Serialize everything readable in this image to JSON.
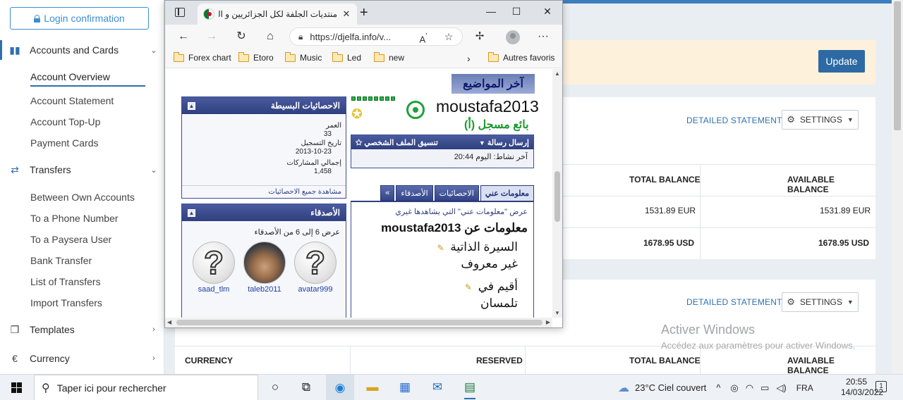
{
  "sidebar": {
    "login_label": "Login confirmation",
    "groups": [
      {
        "label": "Accounts and Cards",
        "icon": "cards-icon"
      },
      {
        "label": "Transfers",
        "icon": "transfer-icon"
      },
      {
        "label": "Templates",
        "icon": "templates-icon"
      },
      {
        "label": "Currency",
        "icon": "currency-icon"
      }
    ],
    "accounts_items": [
      "Account Overview",
      "Account Statement",
      "Account Top-Up",
      "Payment Cards"
    ],
    "transfers_items": [
      "Between Own Accounts",
      "To a Phone Number",
      "To a Paysera User",
      "Bank Transfer",
      "List of Transfers",
      "Import Transfers"
    ]
  },
  "alert": {
    "update_label": "Update"
  },
  "card1": {
    "detailed_label": "DETAILED STATEMENT",
    "settings_label": "SETTINGS",
    "headers": [
      "TOTAL BALANCE",
      "AVAILABLE BALANCE"
    ],
    "rows": [
      [
        "1531.89 EUR",
        "1531.89 EUR"
      ],
      [
        "1678.95 USD",
        "1678.95 USD"
      ]
    ]
  },
  "card2": {
    "detailed_label": "DETAILED STATEMENT",
    "settings_label": "SETTINGS",
    "headers": [
      "CURRENCY",
      "RESERVED",
      "TOTAL BALANCE",
      "AVAILABLE BALANCE"
    ]
  },
  "watermark": {
    "title": "Activer Windows",
    "subtitle": "Accédez aux paramètres pour activer Windows."
  },
  "browser": {
    "tab_title": "منتديات الجلفة لكل الجزائريين و العـ",
    "url": "https://djelfa.info/v...",
    "bookmarks": [
      "Forex chart",
      "Etoro",
      "Music",
      "Led",
      "new"
    ],
    "other_favorites": "Autres favoris"
  },
  "forum": {
    "latest_topics": "آخر المواضيع",
    "username": "moustafa2013",
    "user_title": "بائع مسجل (أ)",
    "send_message": "إرسال رسالة",
    "profile_style": "تنسيق الملف الشخصي",
    "last_activity": "آخر نشاط: اليوم 20:44",
    "tabs": [
      "معلومات عني",
      "الاحصائيات",
      "الأصدقاء",
      "»"
    ],
    "view_about": "عرض \"معلومات عني\" التي يشاهدها غيري",
    "about_heading": "معلومات عن moustafa2013",
    "bio_label": "السيرة الذاتية",
    "bio_value": "غير معروف",
    "location_label": "أقيم في",
    "location_value": "تلمسان",
    "stats_title": "الاحصائيات البسيطة",
    "stats": {
      "age_label": "العمر",
      "age_value": "33",
      "join_label": "تاريخ التسجيل",
      "join_value": "2013-10-23",
      "posts_label": "إجمالي المشاركات",
      "posts_value": "1,458"
    },
    "stats_footer": "مشاهدة جميع الاحصائيات",
    "friends_title": "الأصدقاء",
    "friends_count": "عرض 6 إلى 6 من الأصدقاء",
    "friends": [
      "avatar999",
      "taleb2011",
      "saad_tlm"
    ]
  },
  "taskbar": {
    "search_placeholder": "Taper ici pour rechercher",
    "weather": "23°C  Ciel couvert",
    "lang": "FRA",
    "time": "20:55",
    "date": "14/03/2022",
    "notifications": "1"
  }
}
